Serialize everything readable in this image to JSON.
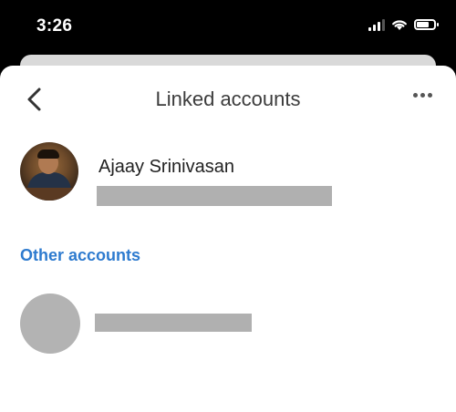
{
  "status_bar": {
    "time": "3:26"
  },
  "header": {
    "title": "Linked accounts"
  },
  "primary_account": {
    "name": "Ajaay Srinivasan"
  },
  "other_accounts": {
    "label": "Other accounts"
  },
  "colors": {
    "accent": "#2e7bcf",
    "redaction": "#b0b0b0"
  }
}
